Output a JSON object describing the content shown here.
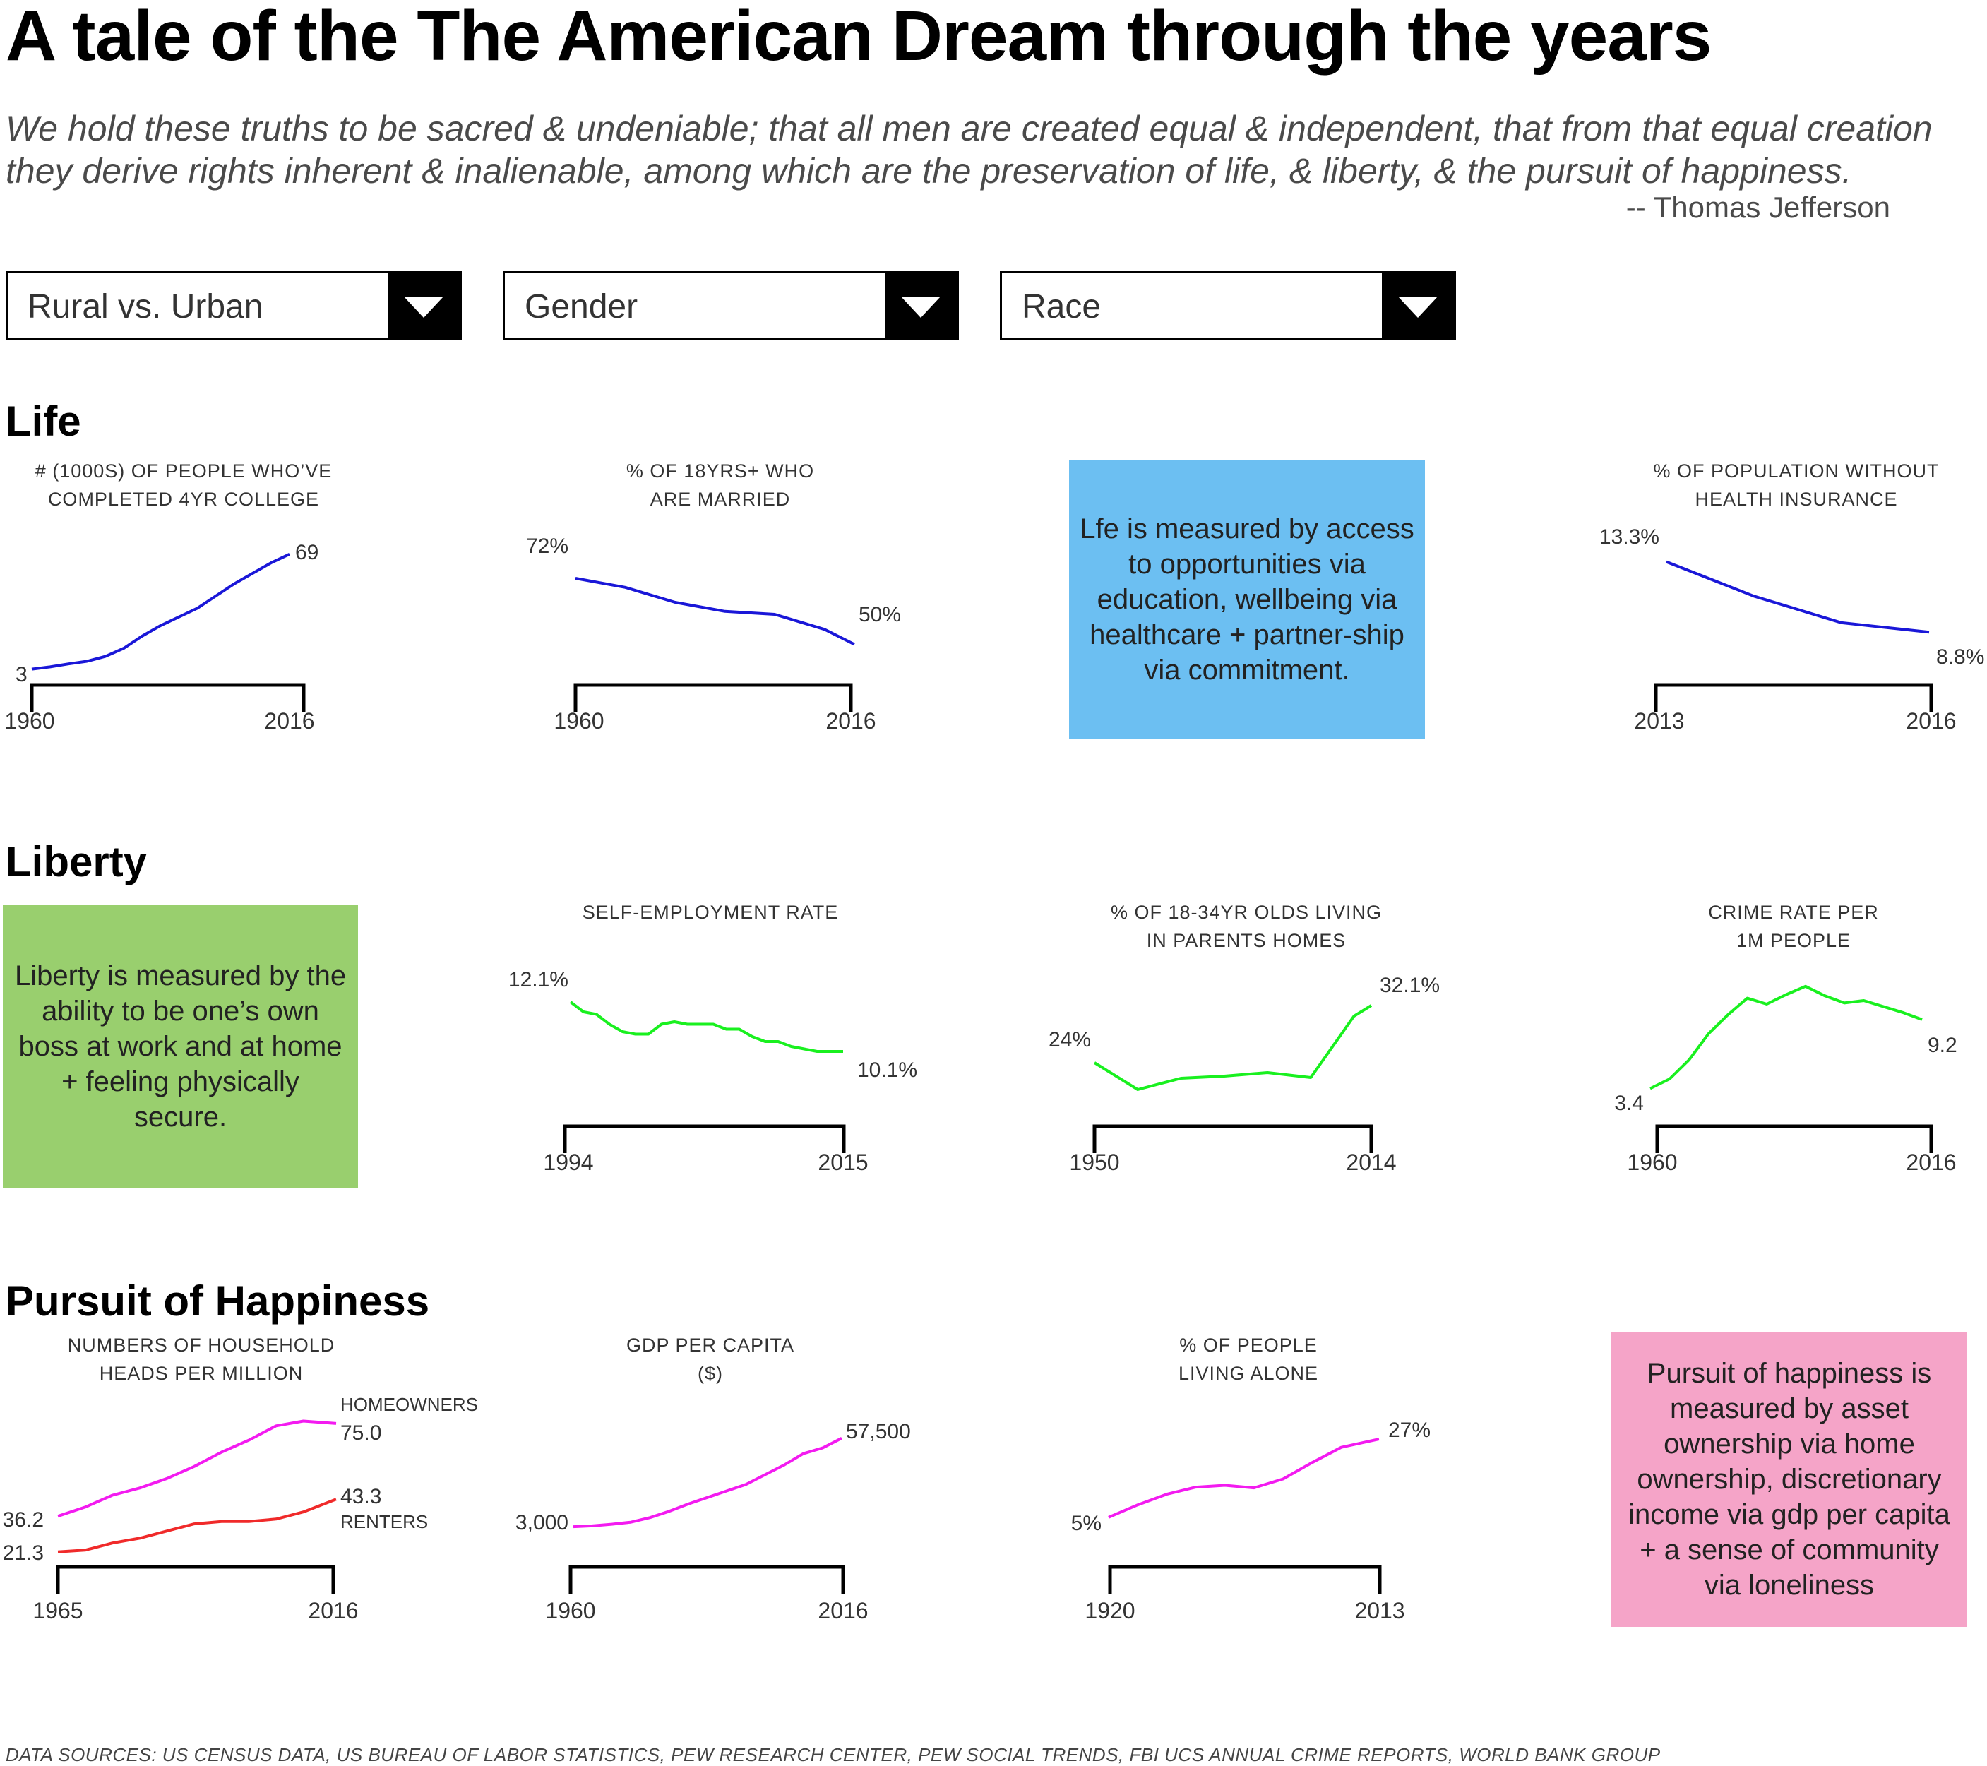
{
  "title": "A tale of the The American Dream through the years",
  "quote": {
    "line1": "We hold these truths to be sacred & undeniable; that all men are created equal & independent, that from that equal creation",
    "line2": "they derive rights inherent & inalienable, among which are the preservation of life, & liberty, & the pursuit of happiness.",
    "author": "-- Thomas Jefferson"
  },
  "filters": [
    {
      "label": "Rural vs. Urban"
    },
    {
      "label": "Gender"
    },
    {
      "label": "Race"
    }
  ],
  "sections": {
    "life": "Life",
    "liberty": "Liberty",
    "happiness": "Pursuit of Happiness"
  },
  "boxes": {
    "life": {
      "text": "Lfe is measured by access to opportunities via education, wellbeing via healthcare + partner-ship via commitment.",
      "color": "#6cbff2"
    },
    "liberty": {
      "text": "Liberty is measured by the ability to be one’s own boss at work and at home + feeling physically secure.",
      "color": "#99cf6e"
    },
    "happiness": {
      "text": "Pursuit of happiness is measured by asset ownership via home ownership, discretionary income via gdp per capita + a sense of community via loneliness",
      "color": "#f5a4c8"
    }
  },
  "colors": {
    "life": "#1a17d8",
    "liberty": "#19f01f",
    "happiness": "#f31bf0",
    "renters": "#f02a2a"
  },
  "sources": "DATA SOURCES: US CENSUS DATA,  US BUREAU OF LABOR STATISTICS, PEW RESEARCH CENTER, PEW SOCIAL TRENDS, FBI UCS ANNUAL CRIME REPORTS, WORLD BANK GROUP",
  "chart_data": [
    {
      "type": "line",
      "title": [
        "# (1000s) of people who’ve",
        "completed 4yr college"
      ],
      "x": [
        1960,
        1964,
        1968,
        1972,
        1976,
        1980,
        1984,
        1988,
        1992,
        1996,
        2000,
        2004,
        2008,
        2012,
        2016
      ],
      "y": [
        3,
        4.3,
        6,
        7.5,
        10.3,
        15,
        22,
        28,
        33,
        38,
        45,
        52,
        58,
        64,
        69
      ],
      "start_label": "3",
      "end_label": "69",
      "x_labels": [
        "1960",
        "2016"
      ],
      "ylim": [
        0,
        75
      ]
    },
    {
      "type": "line",
      "title": [
        "% of 18yrs+ who",
        "are married"
      ],
      "x": [
        1960,
        1970,
        1980,
        1990,
        2000,
        2010,
        2016
      ],
      "y": [
        72,
        69,
        64,
        61,
        60,
        55,
        50
      ],
      "start_label": "72%",
      "end_label": "50%",
      "x_labels": [
        "1960",
        "2016"
      ],
      "ylim": [
        40,
        80
      ]
    },
    {
      "type": "line",
      "title": [
        "% of population without",
        "health insurance"
      ],
      "x": [
        2013,
        2014,
        2015,
        2016
      ],
      "y": [
        13.3,
        11.1,
        9.4,
        8.8
      ],
      "start_label": "13.3%",
      "end_label": "8.8%",
      "x_labels": [
        "2013",
        "2016"
      ],
      "ylim": [
        7,
        15
      ]
    },
    {
      "type": "line",
      "title": [
        "self-employment rate"
      ],
      "x": [
        1994,
        1995,
        1996,
        1997,
        1998,
        1999,
        2000,
        2001,
        2002,
        2003,
        2004,
        2005,
        2006,
        2007,
        2008,
        2009,
        2010,
        2011,
        2012,
        2013,
        2014,
        2015
      ],
      "y": [
        12.1,
        11.7,
        11.6,
        11.2,
        10.9,
        10.8,
        10.8,
        11.2,
        11.3,
        11.2,
        11.2,
        11.2,
        11.0,
        11.0,
        10.7,
        10.5,
        10.5,
        10.3,
        10.2,
        10.1,
        10.1,
        10.1
      ],
      "start_label": "12.1%",
      "end_label": "10.1%",
      "x_labels": [
        "1994",
        "2015"
      ],
      "ylim": [
        9.5,
        12.5
      ]
    },
    {
      "type": "line",
      "title": [
        "% of 18-34yr olds living",
        "in parents homes"
      ],
      "x": [
        1950,
        1960,
        1970,
        1980,
        1990,
        2000,
        2010,
        2014
      ],
      "y": [
        24,
        20.2,
        21.8,
        22.1,
        22.6,
        21.9,
        30.6,
        32.1
      ],
      "start_label": "24%",
      "end_label": "32.1%",
      "x_labels": [
        "1950",
        "2014"
      ],
      "ylim": [
        18,
        34
      ]
    },
    {
      "type": "line",
      "title": [
        "crime rate per",
        "1m people"
      ],
      "x": [
        1960,
        1964,
        1968,
        1972,
        1976,
        1980,
        1984,
        1988,
        1992,
        1996,
        2000,
        2004,
        2008,
        2012,
        2016
      ],
      "y": [
        3.4,
        4.2,
        5.8,
        8.0,
        9.6,
        11.0,
        10.5,
        11.3,
        12.0,
        11.2,
        10.6,
        10.8,
        10.3,
        9.8,
        9.2
      ],
      "start_label": "3.4",
      "end_label": "9.2",
      "x_labels": [
        "1960",
        "2016"
      ],
      "ylim": [
        2,
        13
      ]
    },
    {
      "type": "line",
      "title": [
        "Numbers of household",
        "heads per million"
      ],
      "x": [
        1965,
        1970,
        1975,
        1980,
        1985,
        1990,
        1995,
        2000,
        2005,
        2010,
        2016
      ],
      "series": [
        {
          "name": "homeowners",
          "y": [
            36.2,
            40,
            45,
            48,
            52,
            57,
            63,
            68,
            74,
            76,
            75.0
          ]
        },
        {
          "name": "renters",
          "y": [
            21.3,
            22,
            25,
            27,
            30,
            33,
            34,
            34,
            35,
            38,
            43.3
          ]
        }
      ],
      "labels": {
        "homeowners_start": "36.2",
        "homeowners_end": "75.0",
        "renters_start": "21.3",
        "renters_end": "43.3",
        "homeowners": "HOMEOWNERS",
        "renters": "RENTERS"
      },
      "x_labels": [
        "1965",
        "2016"
      ],
      "ylim": [
        15,
        80
      ]
    },
    {
      "type": "line",
      "title": [
        "GDP per capita",
        "($)"
      ],
      "x": [
        1960,
        1964,
        1968,
        1972,
        1976,
        1980,
        1984,
        1988,
        1992,
        1996,
        2000,
        2004,
        2008,
        2012,
        2016
      ],
      "y": [
        3000,
        3500,
        4500,
        5800,
        8600,
        12500,
        17000,
        21000,
        25000,
        29000,
        35000,
        41000,
        48000,
        51500,
        57500
      ],
      "start_label": "3,000",
      "end_label": "57,500",
      "x_labels": [
        "1960",
        "2016"
      ],
      "ylim": [
        0,
        60000
      ]
    },
    {
      "type": "line",
      "title": [
        "% of people",
        "living alone"
      ],
      "x": [
        1920,
        1930,
        1940,
        1950,
        1960,
        1970,
        1980,
        1990,
        2000,
        2013
      ],
      "y": [
        5,
        8.5,
        11.5,
        13.5,
        14.0,
        13.3,
        15.8,
        20.4,
        24.7,
        27
      ],
      "start_label": "5%",
      "end_label": "27%",
      "x_labels": [
        "1920",
        "2013"
      ],
      "ylim": [
        0,
        30
      ]
    }
  ]
}
